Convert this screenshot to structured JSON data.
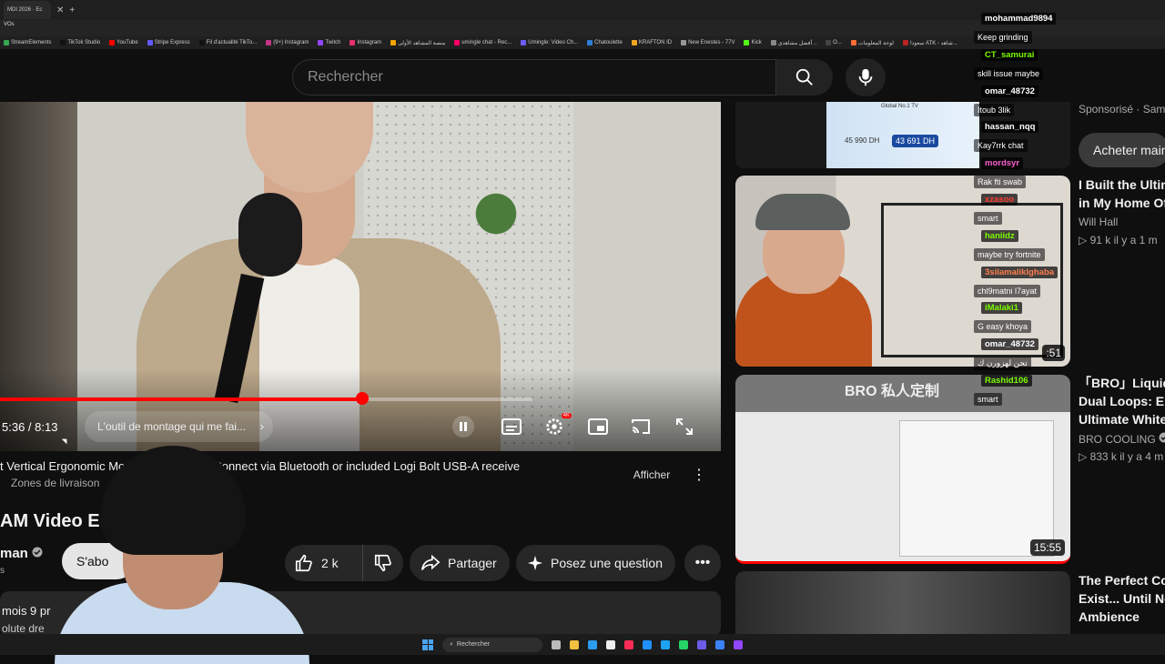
{
  "browser": {
    "tab_title": "MDI 2026 · Ec",
    "address_text": "VOs",
    "bookmarks": [
      "StreamElements",
      "TikTok Studio",
      "YouTube",
      "Stripe Express",
      "Fil d'actualité TikTo...",
      "(9+) Instagram",
      "Twitch",
      "Instagram",
      "منصة المشاهد الأولى",
      "umingle chat - Rec...",
      "Umingle: Video Ch...",
      "Chatoulette",
      "KRAFTON ID",
      "New Enestes - 77V",
      "Kick",
      "أفضل مشاهدي ..",
      "O...",
      "لوحة المعلومات",
      "سعودا ATK - شاهد..."
    ],
    "bookmark_colors": [
      "#34a853",
      "#111111",
      "#ff0000",
      "#635bff",
      "#111111",
      "#c13584",
      "#9146ff",
      "#e1306c",
      "#f4a300",
      "#f06",
      "#6d5cff",
      "#2e7dd7",
      "#f5a623",
      "#999999",
      "#53fc18",
      "#888888",
      "#444444",
      "#ff6b35",
      "#bb2222"
    ]
  },
  "search": {
    "placeholder": "Rechercher",
    "search_icon": "search-icon",
    "mic_icon": "mic-icon"
  },
  "video": {
    "time": "5:36 / 8:13",
    "chapter": "L'outil de montage qui me fai...",
    "chapter_chevron": "›",
    "progress_percent": 68,
    "hd_badge": "4K"
  },
  "product": {
    "title": "t Vertical Ergonomic Mouse - Off White | Connect via Bluetooth or included Logi Bolt USB-A receive",
    "zones": "Zones de livraison",
    "show_label": "Afficher",
    "more": "⋮"
  },
  "meta": {
    "title": "AM Video Ed",
    "channel": "man",
    "subs": "s",
    "subscribe": "S'abo",
    "likes": "2 k",
    "share": "Partager",
    "ask": "Posez une question",
    "more": "•••",
    "desc_line1": "mois  9 pr",
    "desc_line2": "olute dre"
  },
  "sidebar": {
    "ad": {
      "sponsored": "Sponsorisé · Sam",
      "buy": "Acheter main",
      "price_old": "45 990 DH",
      "price_new": "43 691 DH",
      "brand": "Global No.1 TV"
    },
    "videos": [
      {
        "title1": "I Built the Ultim",
        "title2": "in My Home Off",
        "channel": "Will Hall",
        "stats": "▷ 91 k  il y a 1 m",
        "duration": ""
      },
      {
        "title1": "「BRO」Liquid",
        "title2": "Dual Loops: Eng",
        "title3": "Ultimate White",
        "channel": "BRO COOLING",
        "stats": "▷ 833 k  il y a 4 m",
        "duration": "15:55",
        "brand": "BRO 私人定制"
      },
      {
        "title1": "The Perfect Cof",
        "title2": "Exist... Until No",
        "title3": "Ambience",
        "duration": ""
      }
    ]
  },
  "chat": [
    {
      "user": "mohammad9894",
      "text": "Keep grinding",
      "color": "#ffffff"
    },
    {
      "user": "CT_samurai",
      "text": "skill issue maybe",
      "color": "#7CFC00"
    },
    {
      "user": "omar_48732",
      "text": "Itoub 3lik",
      "color": "#ffffff"
    },
    {
      "user": "hassan_nqq",
      "text": "Kay7rrk chat",
      "color": "#ffffff"
    },
    {
      "user": "mordsyr",
      "text": "Rak fti swab",
      "color": "#ff5fd2"
    },
    {
      "user": "xzasoo",
      "text": "smart",
      "color": "#ff3b30"
    },
    {
      "user": "haniidz",
      "text": "maybe try fortnite",
      "color": "#7CFC00"
    },
    {
      "user": "3silamaliklghaba",
      "text": "chl9matni l7ayat",
      "color": "#ff7f50"
    },
    {
      "user": "iMalaki1",
      "text": "G easy khoya",
      "color": "#7CFC00"
    },
    {
      "user": "omar_48732",
      "text": "تحن لهزورن ك",
      "color": "#ffffff"
    },
    {
      "user": "Rashid106",
      "text": "smart",
      "color": "#7CFC00"
    }
  ],
  "thumb1_duration_partial": ":51",
  "taskbar": {
    "search": "Rechercher"
  }
}
